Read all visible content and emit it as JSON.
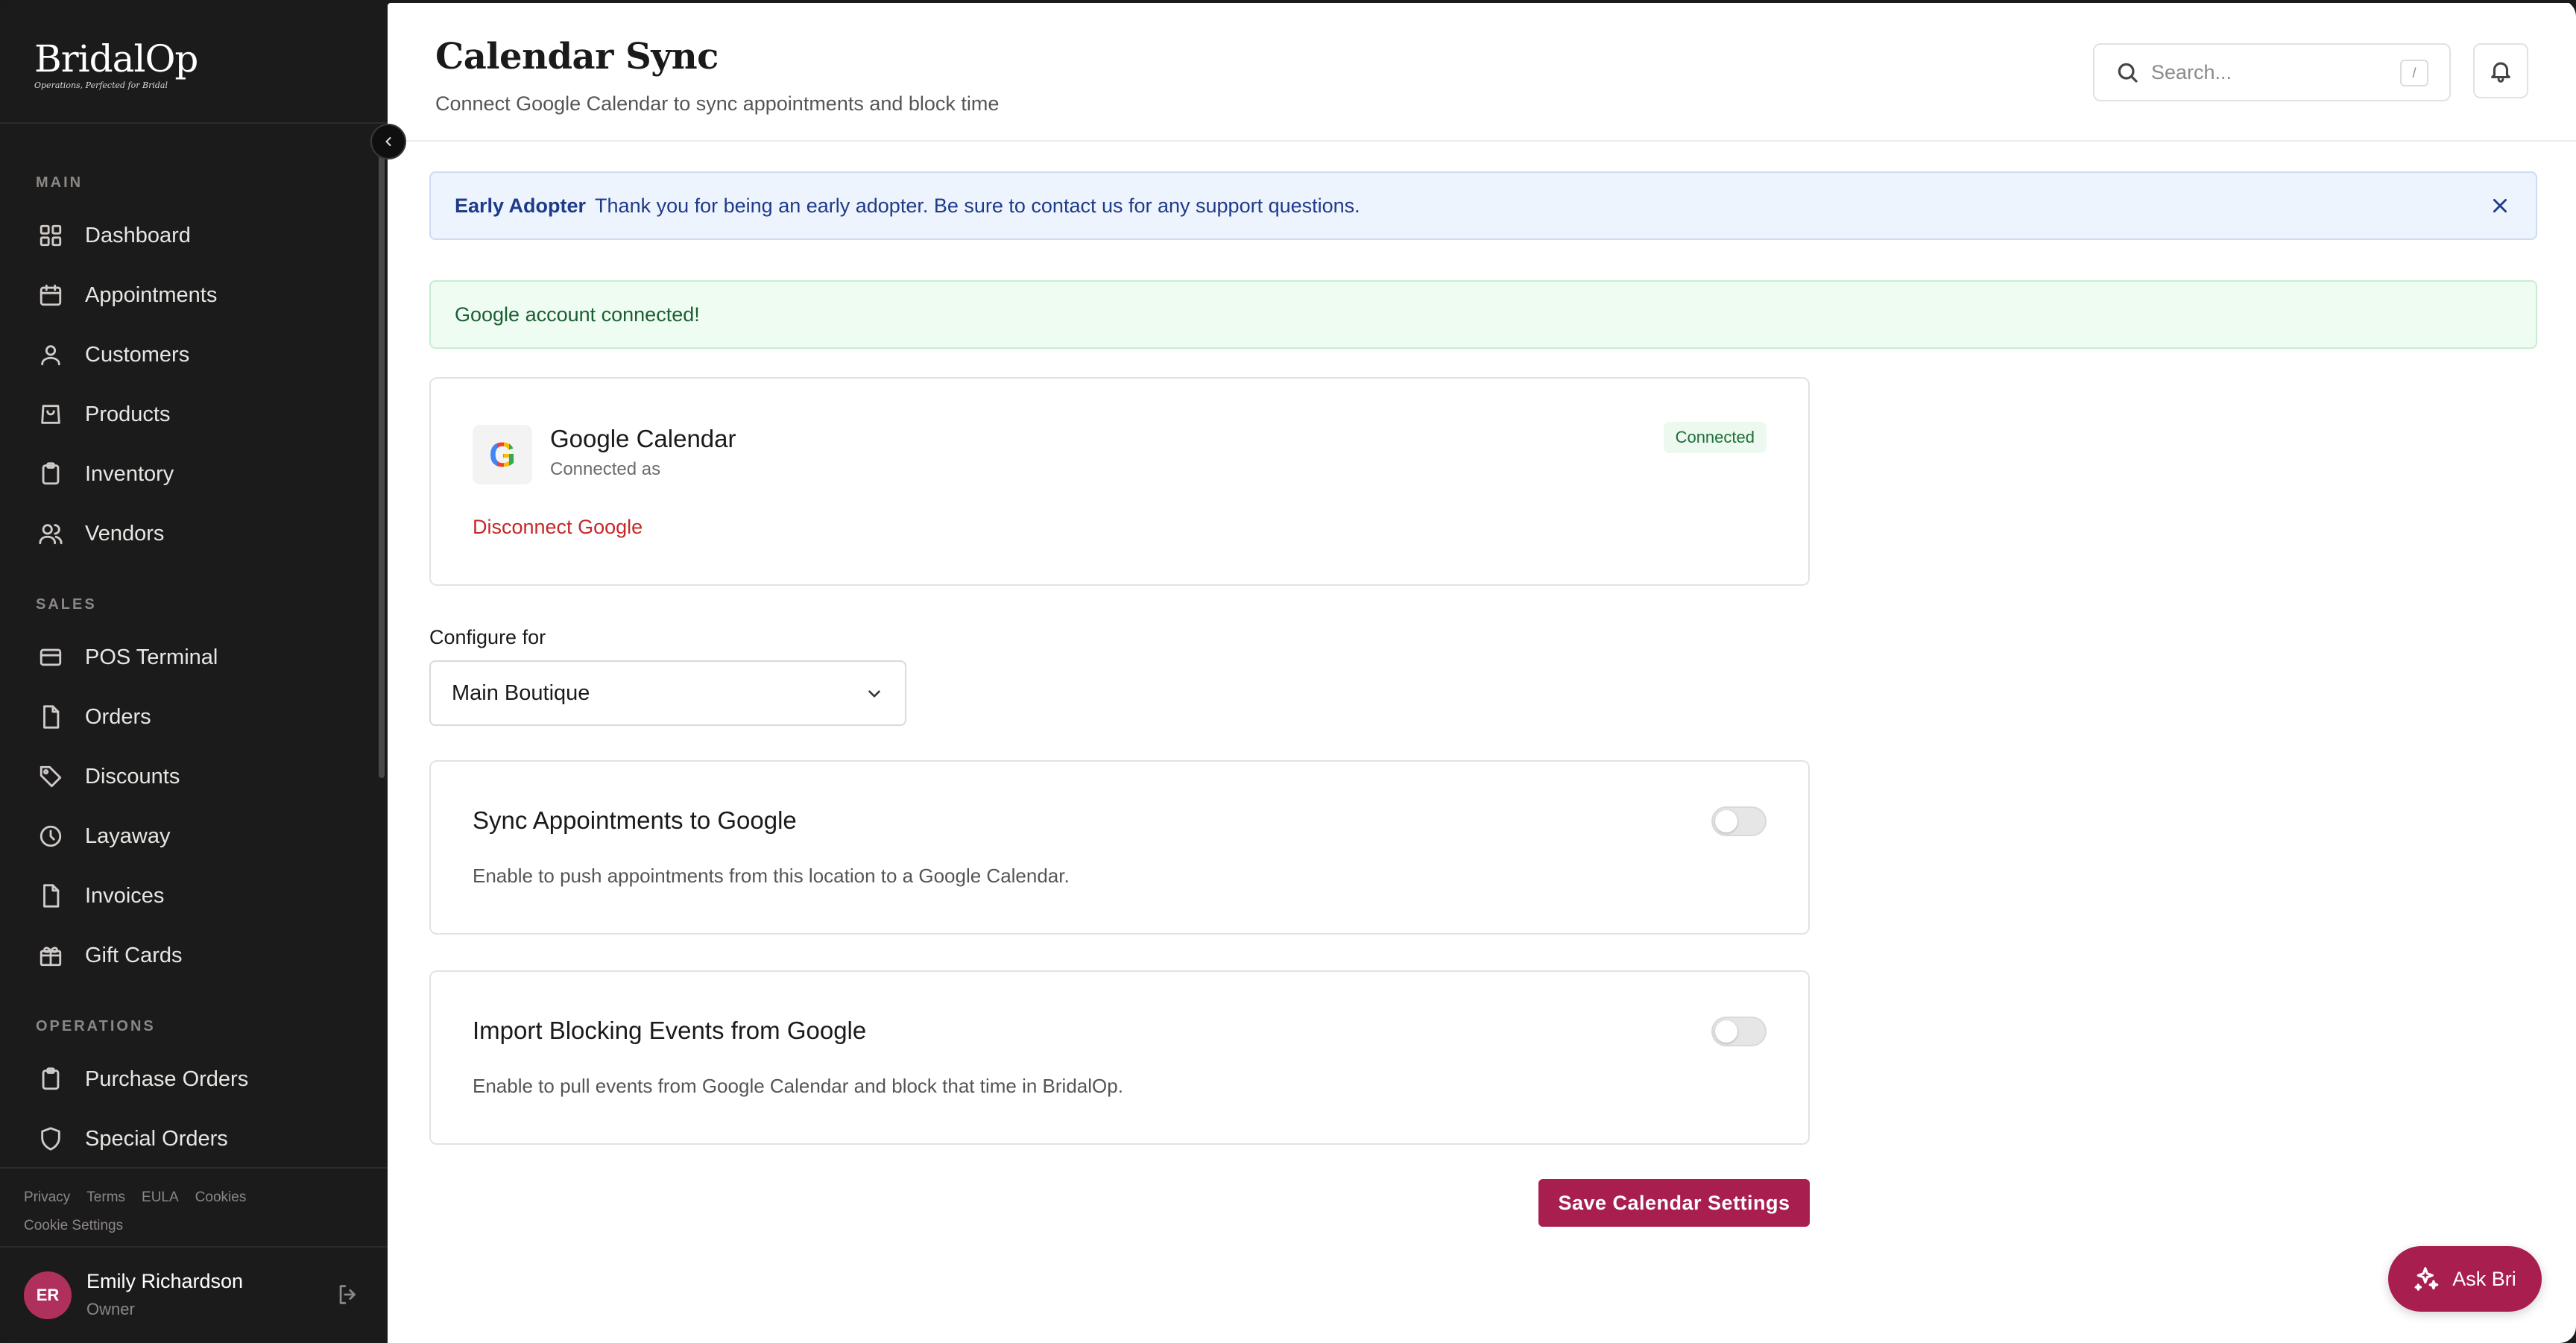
{
  "brand": {
    "name": "BridalOp",
    "tagline": "Operations, Perfected for Bridal"
  },
  "sidebar": {
    "sections": [
      {
        "label": "MAIN",
        "items": [
          {
            "label": "Dashboard",
            "icon": "grid-icon"
          },
          {
            "label": "Appointments",
            "icon": "calendar-icon"
          },
          {
            "label": "Customers",
            "icon": "user-icon"
          },
          {
            "label": "Products",
            "icon": "bag-icon"
          },
          {
            "label": "Inventory",
            "icon": "clipboard-icon"
          },
          {
            "label": "Vendors",
            "icon": "users-icon"
          }
        ]
      },
      {
        "label": "SALES",
        "items": [
          {
            "label": "POS Terminal",
            "icon": "card-icon"
          },
          {
            "label": "Orders",
            "icon": "file-icon"
          },
          {
            "label": "Discounts",
            "icon": "tag-icon"
          },
          {
            "label": "Layaway",
            "icon": "clock-icon"
          },
          {
            "label": "Invoices",
            "icon": "file-icon"
          },
          {
            "label": "Gift Cards",
            "icon": "gift-icon"
          }
        ]
      },
      {
        "label": "OPERATIONS",
        "items": [
          {
            "label": "Purchase Orders",
            "icon": "clipboard-icon"
          },
          {
            "label": "Special Orders",
            "icon": "shield-icon"
          }
        ]
      }
    ],
    "legal": [
      "Privacy",
      "Terms",
      "EULA",
      "Cookies"
    ],
    "cookie_settings": "Cookie Settings",
    "user": {
      "initials": "ER",
      "name": "Emily Richardson",
      "role": "Owner"
    }
  },
  "header": {
    "title": "Calendar Sync",
    "subtitle": "Connect Google Calendar to sync appointments and block time",
    "search_placeholder": "Search...",
    "search_shortcut": "/"
  },
  "banners": {
    "info_label": "Early Adopter",
    "info_text": "Thank you for being an early adopter. Be sure to contact us for any support questions.",
    "success_text": "Google account connected!"
  },
  "google_card": {
    "logo_letter": "G",
    "name": "Google Calendar",
    "connected_as": "Connected as",
    "status": "Connected",
    "disconnect_label": "Disconnect Google"
  },
  "configure": {
    "label": "Configure for",
    "selected": "Main Boutique"
  },
  "sync_card": {
    "title": "Sync Appointments to Google",
    "description": "Enable to push appointments from this location to a Google Calendar.",
    "enabled": false
  },
  "import_card": {
    "title": "Import Blocking Events from Google",
    "description": "Enable to pull events from Google Calendar and block that time in BridalOp.",
    "enabled": false
  },
  "save_label": "Save Calendar Settings",
  "assistant_label": "Ask Bri",
  "colors": {
    "accent": "#a81e4f",
    "sidebar_bg": "#1c1b1b",
    "info_bg": "#eef4fd",
    "success_bg": "#eefcf2",
    "danger": "#c62828"
  }
}
